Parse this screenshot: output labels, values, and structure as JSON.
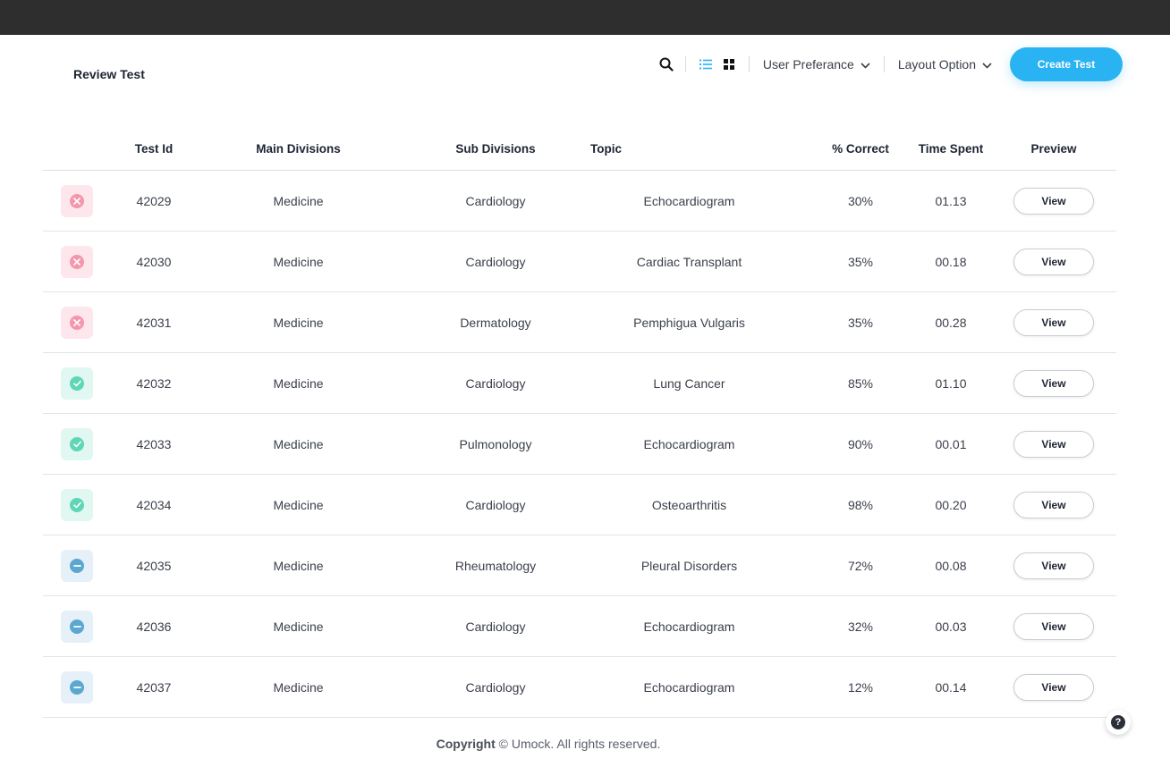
{
  "page": {
    "title": "Review Test"
  },
  "toolbar": {
    "search_icon": "search-icon",
    "list_view_icon": "list-view-icon",
    "grid_view_icon": "grid-view-icon",
    "user_pref_label": "User Preferance",
    "layout_option_label": "Layout Option",
    "create_label": "Create Test",
    "accent_color": "#2ab3f3"
  },
  "table": {
    "headers": [
      "",
      "Test Id",
      "Main Divisions",
      "Sub Divisions",
      "Topic",
      "% Correct",
      "Time Spent",
      "Preview"
    ],
    "rows": [
      {
        "status": "fail",
        "status_icon": "close-icon",
        "id": "42029",
        "main": "Medicine",
        "sub": "Cardiology",
        "topic": "Echocardiogram",
        "correct": "30%",
        "time": "01.13",
        "preview": "View"
      },
      {
        "status": "fail",
        "status_icon": "close-icon",
        "id": "42030",
        "main": "Medicine",
        "sub": "Cardiology",
        "topic": "Cardiac Transplant",
        "correct": "35%",
        "time": "00.18",
        "preview": "View"
      },
      {
        "status": "fail",
        "status_icon": "close-icon",
        "id": "42031",
        "main": "Medicine",
        "sub": "Dermatology",
        "topic": "Pemphigua Vulgaris",
        "correct": "35%",
        "time": "00.28",
        "preview": "View"
      },
      {
        "status": "pass",
        "status_icon": "check-icon",
        "id": "42032",
        "main": "Medicine",
        "sub": "Cardiology",
        "topic": "Lung Cancer",
        "correct": "85%",
        "time": "01.10",
        "preview": "View"
      },
      {
        "status": "pass",
        "status_icon": "check-icon",
        "id": "42033",
        "main": "Medicine",
        "sub": "Pulmonology",
        "topic": "Echocardiogram",
        "correct": "90%",
        "time": "00.01",
        "preview": "View"
      },
      {
        "status": "pass",
        "status_icon": "check-icon",
        "id": "42034",
        "main": "Medicine",
        "sub": "Cardiology",
        "topic": "Osteoarthritis",
        "correct": "98%",
        "time": "00.20",
        "preview": "View"
      },
      {
        "status": "neutral",
        "status_icon": "minus-icon",
        "id": "42035",
        "main": "Medicine",
        "sub": "Rheumatology",
        "topic": "Pleural Disorders",
        "correct": "72%",
        "time": "00.08",
        "preview": "View"
      },
      {
        "status": "neutral",
        "status_icon": "minus-icon",
        "id": "42036",
        "main": "Medicine",
        "sub": "Cardiology",
        "topic": "Echocardiogram",
        "correct": "32%",
        "time": "00.03",
        "preview": "View"
      },
      {
        "status": "neutral",
        "status_icon": "minus-icon",
        "id": "42037",
        "main": "Medicine",
        "sub": "Cardiology",
        "topic": "Echocardiogram",
        "correct": "12%",
        "time": "00.14",
        "preview": "View"
      }
    ]
  },
  "status_colors": {
    "fail": "#f497ad",
    "pass": "#5fd6b6",
    "neutral": "#5aa7cf"
  },
  "footer": {
    "copyright_bold": "Copyright",
    "copyright_rest": "© Umock. All rights reserved."
  },
  "help": {
    "icon": "help-icon",
    "label": "?"
  }
}
